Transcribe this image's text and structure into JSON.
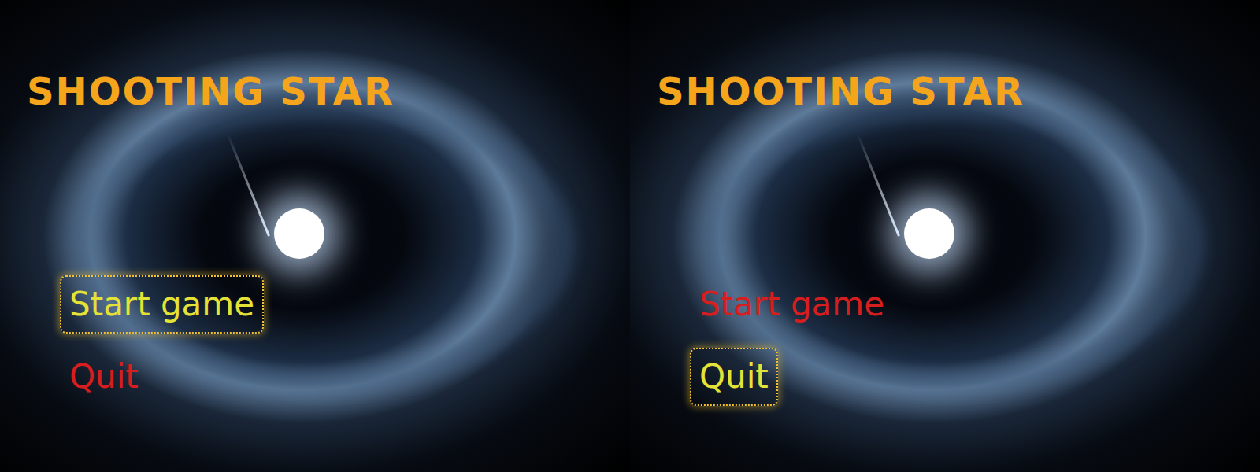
{
  "panels": [
    {
      "title": "SHOOTING STAR",
      "menu": [
        {
          "label": "Start game",
          "selected": true
        },
        {
          "label": "Quit",
          "selected": false
        }
      ]
    },
    {
      "title": "SHOOTING STAR",
      "menu": [
        {
          "label": "Start game",
          "selected": false
        },
        {
          "label": "Quit",
          "selected": true
        }
      ]
    }
  ]
}
